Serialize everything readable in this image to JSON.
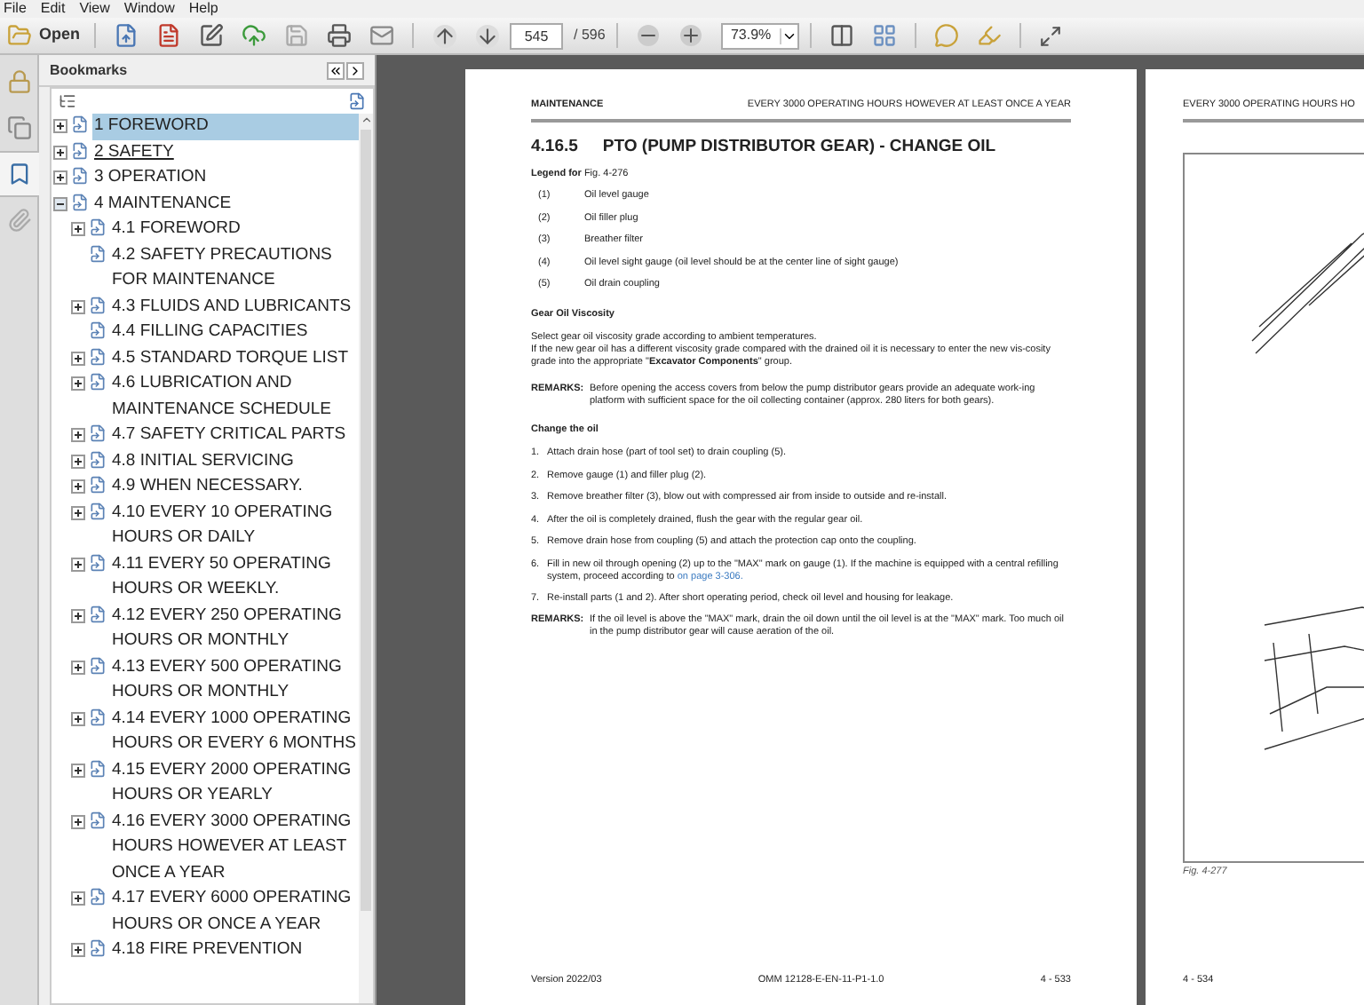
{
  "menu": [
    "File",
    "Edit",
    "View",
    "Window",
    "Help"
  ],
  "toolbar": {
    "open_label": "Open",
    "page_value": "545",
    "page_total": "/ 596",
    "zoom_value": "73.9%"
  },
  "side_tabs": [
    {
      "kind": "lock",
      "selected": false
    },
    {
      "kind": "pages",
      "selected": false
    },
    {
      "kind": "bookmarks",
      "selected": true
    },
    {
      "kind": "attachments",
      "selected": false
    }
  ],
  "bookmarks": {
    "title": "Bookmarks",
    "items": [
      {
        "label": "1 FOREWORD",
        "expanded": false,
        "selected": true,
        "hovered": false
      },
      {
        "label": "2 SAFETY",
        "expanded": false,
        "selected": false,
        "hovered": true
      },
      {
        "label": "3 OPERATION",
        "expanded": false,
        "selected": false,
        "hovered": false
      },
      {
        "label": "4 MAINTENANCE",
        "expanded": true,
        "selected": false,
        "hovered": false,
        "children": [
          {
            "label": "4.1 FOREWORD",
            "expanded": false,
            "selected": false,
            "hovered": false
          },
          {
            "label": "4.2 SAFETY PRECAUTIONS FOR MAINTENANCE",
            "selected": false,
            "hovered": false
          },
          {
            "label": "4.3 FLUIDS AND LUBRICANTS",
            "expanded": false,
            "selected": false,
            "hovered": false
          },
          {
            "label": "4.4 FILLING CAPACITIES",
            "selected": false,
            "hovered": false
          },
          {
            "label": "4.5 STANDARD TORQUE LIST",
            "expanded": false,
            "selected": false,
            "hovered": false
          },
          {
            "label": "4.6 LUBRICATION AND MAINTENANCE SCHEDULE",
            "expanded": false,
            "selected": false,
            "hovered": false
          },
          {
            "label": "4.7 SAFETY CRITICAL PARTS",
            "expanded": false,
            "selected": false,
            "hovered": false
          },
          {
            "label": "4.8 INITIAL SERVICING",
            "expanded": false,
            "selected": false,
            "hovered": false
          },
          {
            "label": "4.9 WHEN NECESSARY.",
            "expanded": false,
            "selected": false,
            "hovered": false
          },
          {
            "label": "4.10 EVERY 10 OPERATING HOURS OR DAILY",
            "expanded": false,
            "selected": false,
            "hovered": false
          },
          {
            "label": "4.11 EVERY 50 OPERATING HOURS OR WEEKLY.",
            "expanded": false,
            "selected": false,
            "hovered": false
          },
          {
            "label": "4.12 EVERY 250 OPERATING HOURS OR MONTHLY",
            "expanded": false,
            "selected": false,
            "hovered": false
          },
          {
            "label": "4.13 EVERY 500 OPERATING HOURS OR MONTHLY",
            "expanded": false,
            "selected": false,
            "hovered": false
          },
          {
            "label": "4.14 EVERY 1000 OPERATING HOURS OR EVERY 6 MONTHS",
            "expanded": false,
            "selected": false,
            "hovered": false
          },
          {
            "label": "4.15 EVERY 2000 OPERATING HOURS OR YEARLY",
            "expanded": false,
            "selected": false,
            "hovered": false
          },
          {
            "label": "4.16 EVERY 3000 OPERATING HOURS HOWEVER AT LEAST ONCE A YEAR",
            "expanded": false,
            "selected": false,
            "hovered": false
          },
          {
            "label": "4.17 EVERY 6000 OPERATING HOURS OR ONCE A YEAR",
            "expanded": false,
            "selected": false,
            "hovered": false
          },
          {
            "label": "4.18 FIRE PREVENTION",
            "expanded": false,
            "selected": false,
            "hovered": false
          }
        ]
      }
    ]
  },
  "page_left": {
    "header_left": "MAINTENANCE",
    "header_right": "EVERY 3000 OPERATING HOURS HOWEVER AT LEAST ONCE A YEAR",
    "section_number": "4.16.5",
    "section_title": "PTO (PUMP DISTRIBUTOR GEAR) - CHANGE OIL",
    "legend_title": "**Legend for** Fig. 4-276",
    "legend": [
      {
        "number": "(1)",
        "text": "Oil level gauge"
      },
      {
        "number": "(2)",
        "text": "Oil filler plug"
      },
      {
        "number": "(3)",
        "text": "Breather filter"
      },
      {
        "number": "(4)",
        "text": "Oil level sight gauge (oil level should be at the center line of sight gauge)"
      },
      {
        "number": "(5)",
        "text": "Oil drain coupling"
      }
    ],
    "viscosity_heading": "Gear Oil Viscosity",
    "viscosity_text": [
      "Select gear oil viscosity grade according to ambient temperatures.",
      "If the new gear oil has a different viscosity grade compared with the drained oil it is necessary to enter the new vis-cosity grade into the appropriate \"**Excavator Components**\" group."
    ],
    "remarks_1": {
      "label": "REMARKS:",
      "text": "Before opening the access covers from below the pump distributor gears provide an adequate work-ing platform with sufficient space for the oil collecting container (approx. 280 liters for both gears)."
    },
    "steps_heading": "Change the oil",
    "steps": [
      {
        "number": "1.",
        "text": "Attach drain hose (part of tool set) to drain coupling (5)."
      },
      {
        "number": "2.",
        "text": "Remove gauge (1) and filler plug (2)."
      },
      {
        "number": "3.",
        "text": "Remove breather filter (3), blow out with compressed air from inside to outside and re-install."
      },
      {
        "number": "4.",
        "text": "After the oil is completely drained, flush the gear with the regular gear oil."
      },
      {
        "number": "5.",
        "text": "Remove drain hose from coupling (5) and attach the protection cap onto the coupling."
      },
      {
        "number": "6.",
        "text": "Fill in new oil through opening (2) up to the \"MAX\" mark on gauge (1). If the machine is equipped with a central refilling system, proceed according to",
        "link": "on page 3-306."
      },
      {
        "number": "7.",
        "text": "Re-install parts (1 and 2). After short operating period, check oil level and housing for leakage."
      }
    ],
    "remarks_2": {
      "label": "REMARKS:",
      "text": "If the oil level is above the \"MAX\" mark, drain the oil down until the oil level is at the \"MAX\" mark. Too much oil in the pump distributor gear will cause aeration of the oil."
    },
    "footer": [
      "Version 2022/03",
      "OMM 12128-E-EN-11-P1-1.0",
      "4 - 533"
    ]
  },
  "page_right": {
    "header": "EVERY 3000 OPERATING HOURS HO",
    "caption": "Fig. 4-277",
    "footer": "4 - 534"
  }
}
